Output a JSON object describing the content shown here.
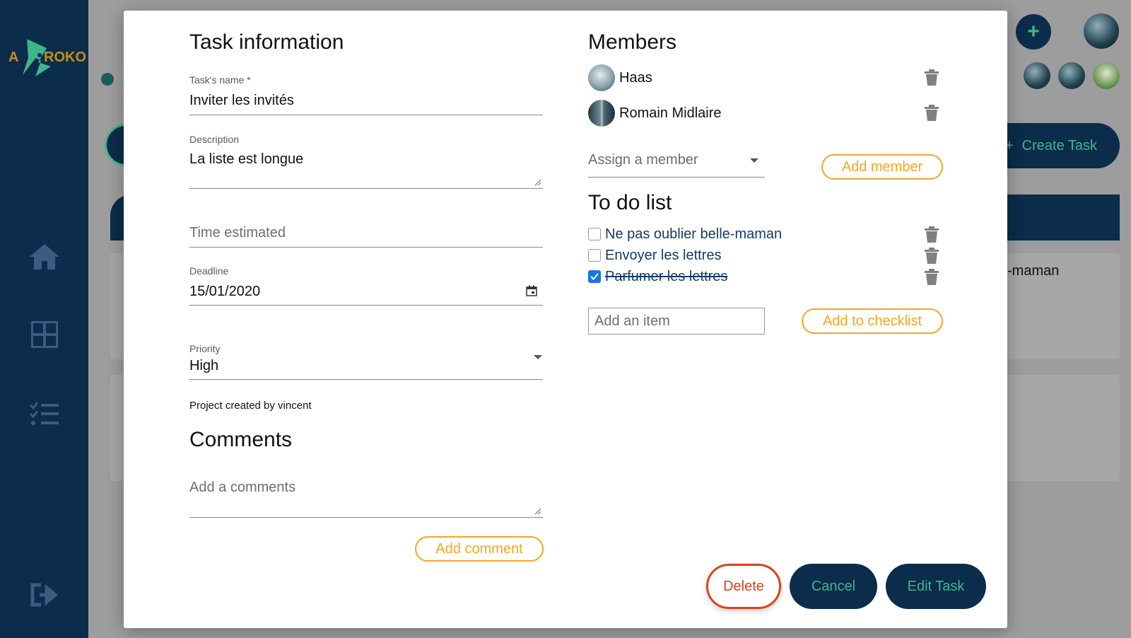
{
  "sidebar": {
    "logo_text_left": "A",
    "logo_text_right": "ROKO"
  },
  "background": {
    "create_task_label": "Create Task",
    "create_task_icon": "+",
    "plus_icon": "+",
    "card_text": "-maman"
  },
  "task_info": {
    "heading": "Task information",
    "name_label": "Task's name *",
    "name_value": "Inviter les invités",
    "description_label": "Description",
    "description_value": "La liste est longue",
    "time_placeholder": "Time estimated",
    "deadline_label": "Deadline",
    "deadline_value": "15/01/2020",
    "priority_label": "Priority",
    "priority_value": "High",
    "created_by": "Project created by vincent"
  },
  "comments": {
    "heading": "Comments",
    "placeholder": "Add a comments",
    "add_button": "Add comment"
  },
  "members": {
    "heading": "Members",
    "list": [
      {
        "name": "Haas"
      },
      {
        "name": "Romain Midlaire"
      }
    ],
    "assign_placeholder": "Assign a member",
    "add_button": "Add member"
  },
  "todo": {
    "heading": "To do list",
    "items": [
      {
        "text": "Ne pas oublier belle-maman",
        "checked": false
      },
      {
        "text": "Envoyer les lettres",
        "checked": false
      },
      {
        "text": "Parfumer les lettres",
        "checked": true
      }
    ],
    "add_placeholder": "Add an item",
    "add_button": "Add to checklist"
  },
  "actions": {
    "delete": "Delete",
    "cancel": "Cancel",
    "edit": "Edit Task"
  },
  "colors": {
    "navy": "#0b2c4b",
    "green": "#3fb68a",
    "orange": "#f5a623",
    "delete_red": "#d9451c",
    "todo_text": "#123c67",
    "check_blue": "#1a73e8"
  },
  "icons": {
    "home": "home-icon",
    "grid": "grid-icon",
    "checklist": "checklist-icon",
    "logout": "logout-icon",
    "trash": "trash-icon",
    "calendar": "calendar-icon",
    "dropdown": "chevron-down-icon"
  }
}
